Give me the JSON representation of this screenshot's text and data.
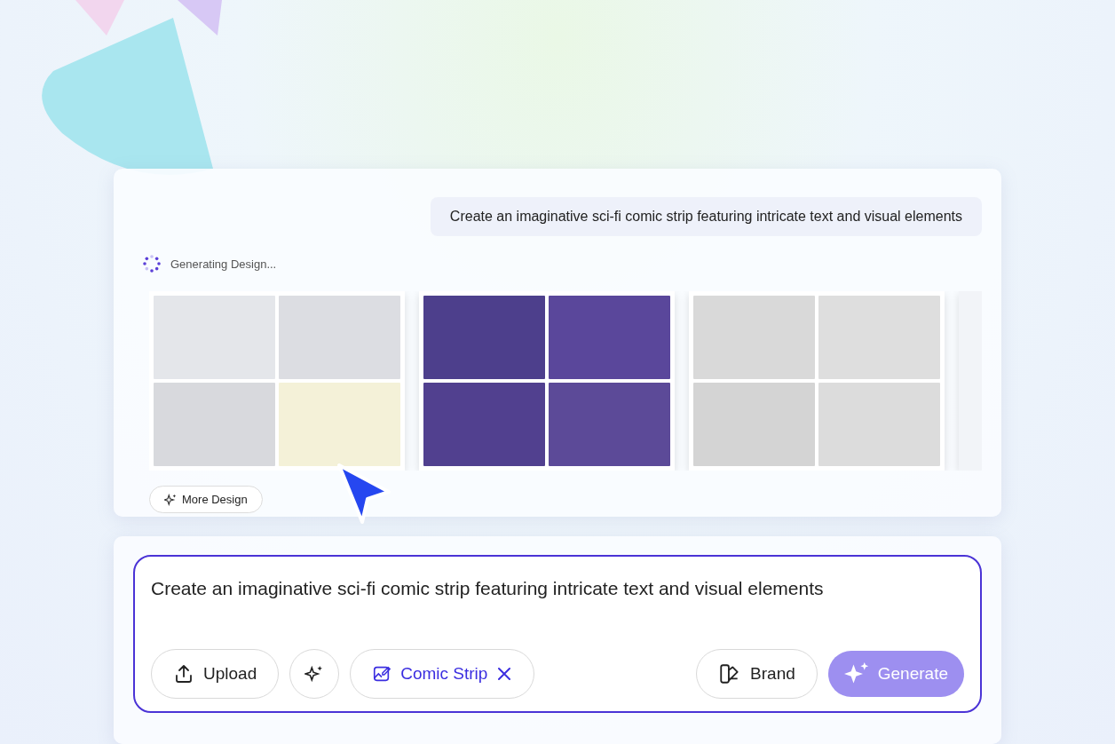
{
  "chat": {
    "prompt": "Create an imaginative sci-fi comic strip featuring intricate text and visual elements",
    "status": "Generating Design...",
    "more_button": "More Design"
  },
  "composer": {
    "text": "Create an imaginative sci-fi comic strip featuring intricate text and visual elements",
    "upload": "Upload",
    "chip": {
      "label": "Comic Strip",
      "removable": true
    },
    "brand": "Brand",
    "generate": {
      "label": "Generate",
      "disabled": true
    }
  }
}
